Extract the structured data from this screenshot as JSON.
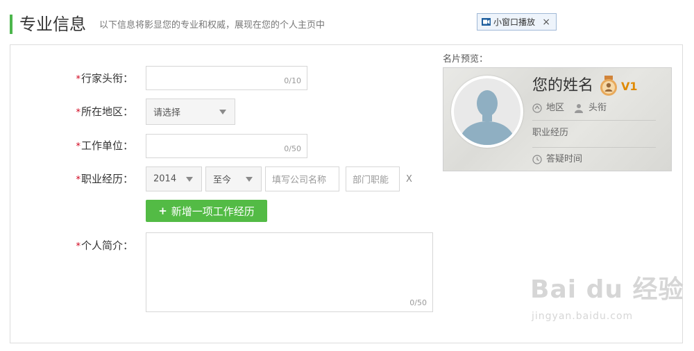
{
  "header": {
    "title": "专业信息",
    "subtitle": "以下信息将影显您的专业和权威，展现在您的个人主页中",
    "mini_player": {
      "icon": "video-camera-icon",
      "label": "小窗口播放",
      "close": "×"
    }
  },
  "form": {
    "title_field": {
      "required": "*",
      "label": "行家头衔：",
      "value": "",
      "counter": "0/10"
    },
    "region_field": {
      "required": "*",
      "label": "所在地区：",
      "selected": "请选择"
    },
    "company_field": {
      "required": "*",
      "label": "工作单位：",
      "value": "",
      "counter": "0/50"
    },
    "experience_field": {
      "required": "*",
      "label": "职业经历：",
      "start_year": "2014",
      "end": "至今",
      "company_placeholder": "填写公司名称",
      "department_placeholder": "部门职能",
      "remove": "X"
    },
    "add_experience_button": {
      "plus": "+",
      "label": "新增一项工作经历"
    },
    "bio_field": {
      "required": "*",
      "label": "个人简介：",
      "value": "",
      "counter": "0/50"
    }
  },
  "card_preview": {
    "label": "名片预览：",
    "name": "您的姓名",
    "level": "V1",
    "region": "地区",
    "title": "头衔",
    "experience": "职业经历",
    "answer_time": "答疑时间"
  },
  "watermark": {
    "brand": "Bai du 经验",
    "url": "jingyan.baidu.com"
  },
  "colors": {
    "accent_green": "#53bb45",
    "required_red": "#d0021b",
    "level_orange": "#e08a00"
  }
}
